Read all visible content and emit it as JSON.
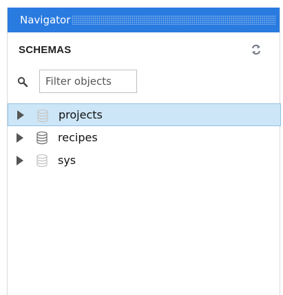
{
  "navigator": {
    "title": "Navigator"
  },
  "schemas": {
    "title": "SCHEMAS",
    "refresh_icon": "refresh-icon"
  },
  "search": {
    "placeholder": "Filter objects",
    "value": "",
    "icon": "search-icon"
  },
  "tree": {
    "items": [
      {
        "label": "projects",
        "selected": true,
        "icon": "database-icon",
        "icon_color": "#c8c8c8"
      },
      {
        "label": "recipes",
        "selected": false,
        "icon": "database-icon",
        "icon_color": "#7a7a7a"
      },
      {
        "label": "sys",
        "selected": false,
        "icon": "database-icon",
        "icon_color": "#c8c8c8"
      }
    ]
  },
  "colors": {
    "header_bg": "#2a7be0",
    "selection_bg": "#cde6f7",
    "selection_border": "#8ec1e6"
  }
}
